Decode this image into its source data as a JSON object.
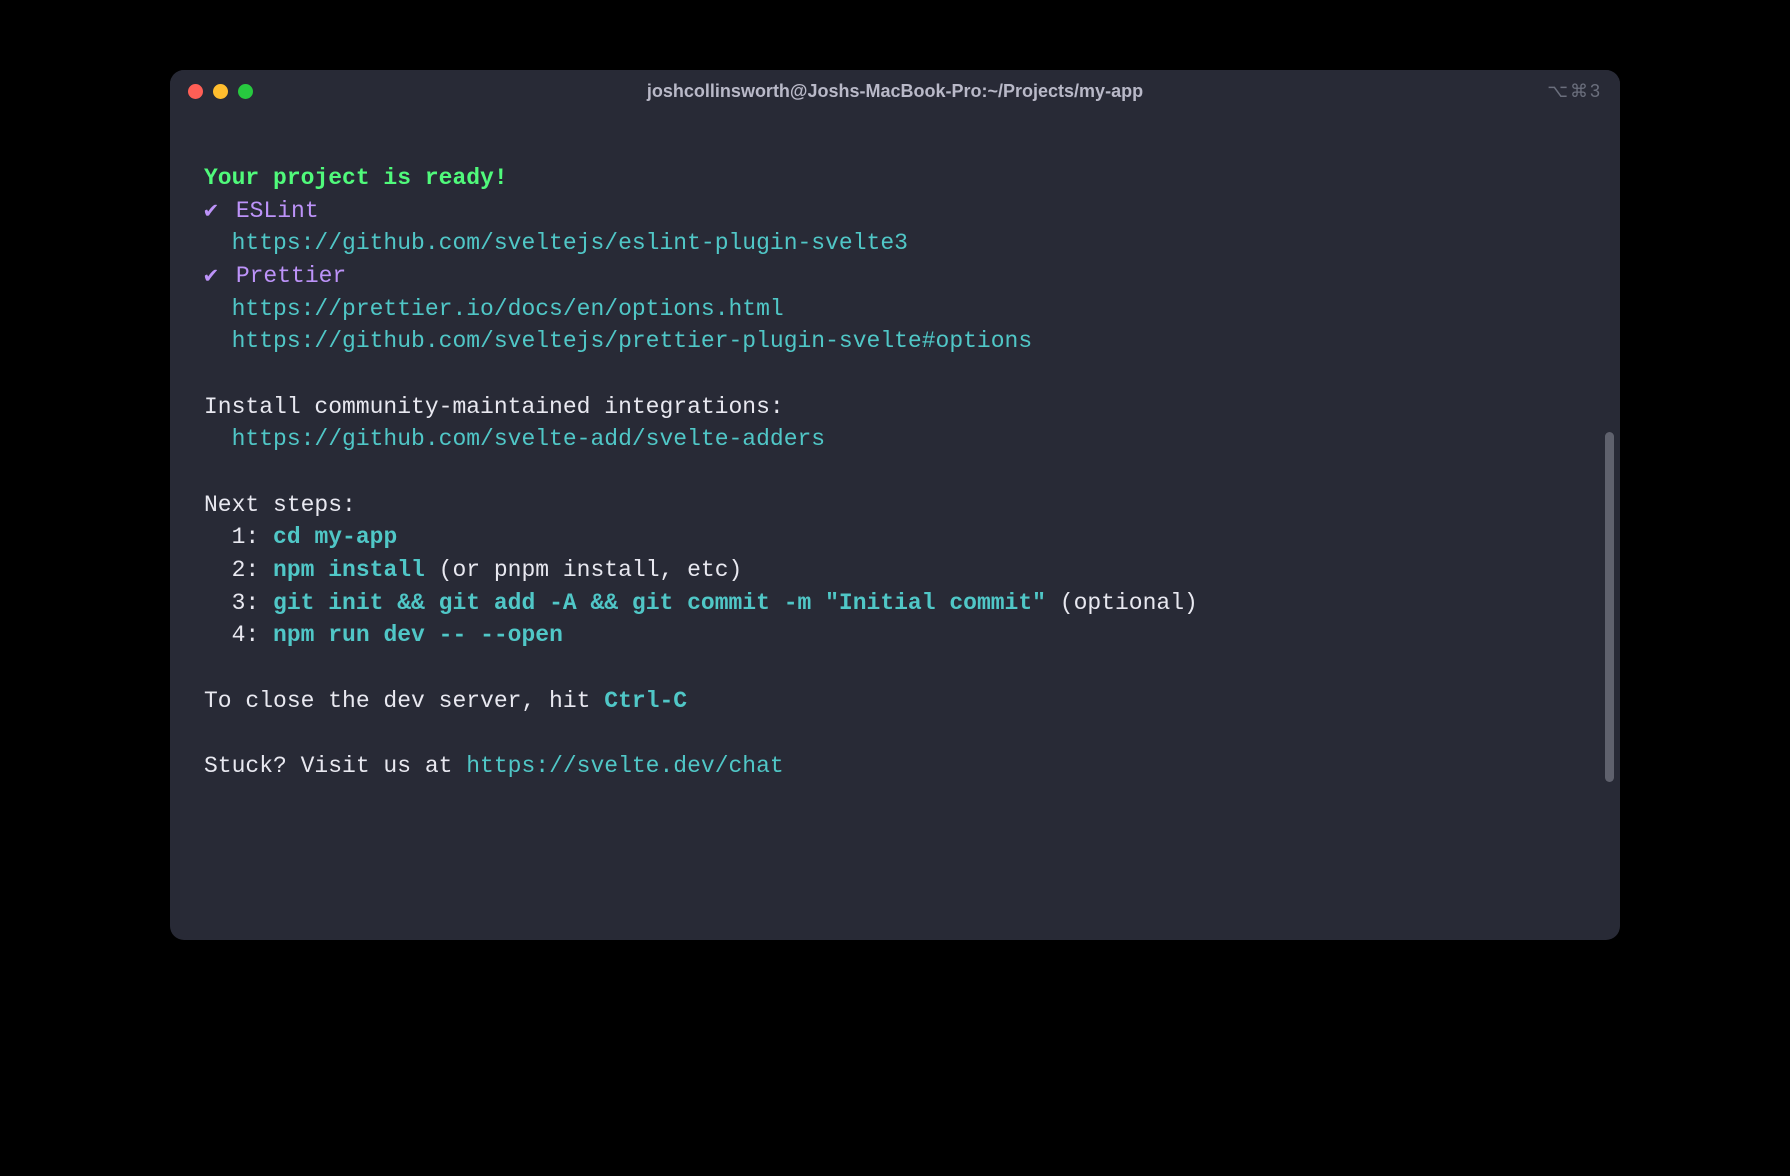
{
  "window": {
    "title": "joshcollinsworth@Joshs-MacBook-Pro:~/Projects/my-app",
    "right_indicator": "⌥⌘3"
  },
  "output": {
    "ready_heading": "Your project is ready!",
    "tools": [
      {
        "name": "ESLint",
        "links": [
          "https://github.com/sveltejs/eslint-plugin-svelte3"
        ]
      },
      {
        "name": "Prettier",
        "links": [
          "https://prettier.io/docs/en/options.html",
          "https://github.com/sveltejs/prettier-plugin-svelte#options"
        ]
      }
    ],
    "install_community_label": "Install community-maintained integrations:",
    "install_community_link": "https://github.com/svelte-add/svelte-adders",
    "next_steps_label": "Next steps:",
    "steps": [
      {
        "num": "1:",
        "cmd": "cd my-app",
        "suffix": ""
      },
      {
        "num": "2:",
        "cmd": "npm install",
        "suffix": " (or pnpm install, etc)"
      },
      {
        "num": "3:",
        "cmd": "git init && git add -A && git commit -m \"Initial commit\"",
        "suffix": " (optional)"
      },
      {
        "num": "4:",
        "cmd": "npm run dev -- --open",
        "suffix": ""
      }
    ],
    "close_server_prefix": "To close the dev server, hit ",
    "close_server_key": "Ctrl-C",
    "stuck_prefix": "Stuck? Visit us at ",
    "stuck_link": "https://svelte.dev/chat"
  }
}
